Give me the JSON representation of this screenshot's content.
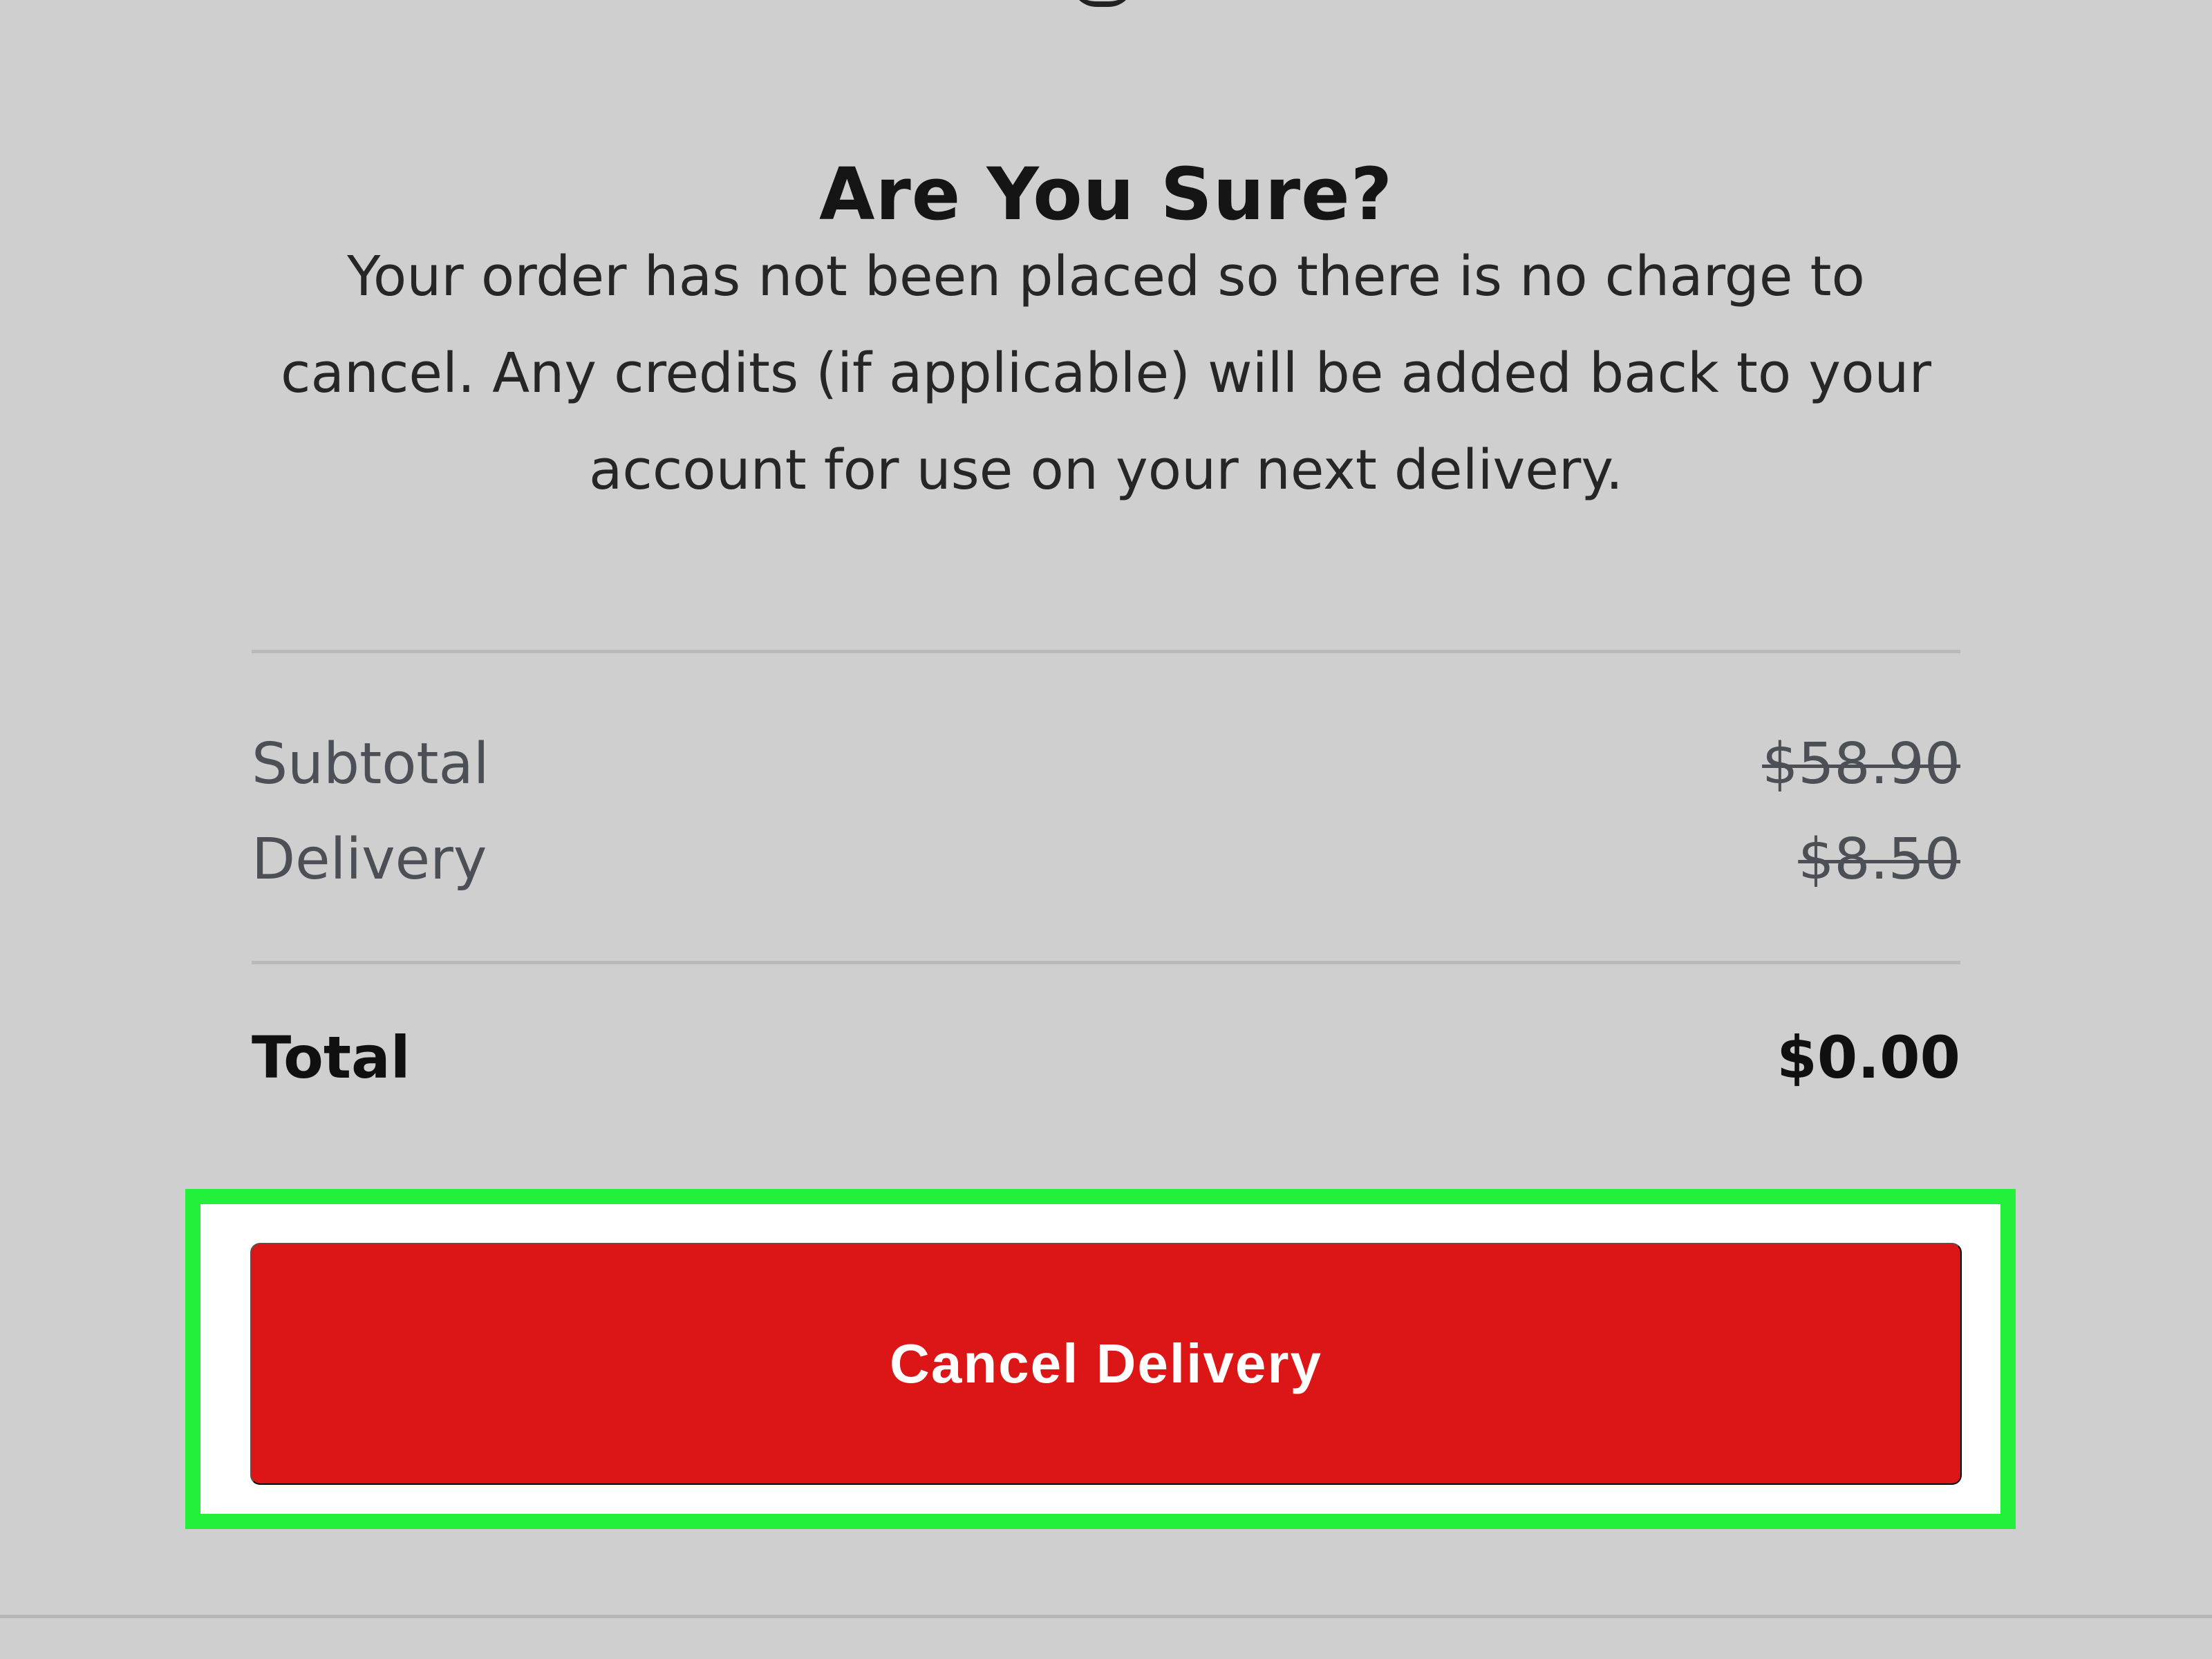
{
  "dialog": {
    "title": "Are You Sure?",
    "message": "Your order has not been placed so there is no charge to cancel. Any credits (if applicable) will be added back to your account for use on your next delivery."
  },
  "summary": {
    "items": [
      {
        "label": "Subtotal",
        "value": "$58.90",
        "struck": true
      },
      {
        "label": "Delivery",
        "value": "$8.50",
        "struck": true
      }
    ],
    "total": {
      "label": "Total",
      "value": "$0.00"
    }
  },
  "actions": {
    "cancel_delivery_label": "Cancel Delivery"
  },
  "colors": {
    "background": "#cfcfcf",
    "button": "#dc1616",
    "highlight": "#23f03a"
  }
}
